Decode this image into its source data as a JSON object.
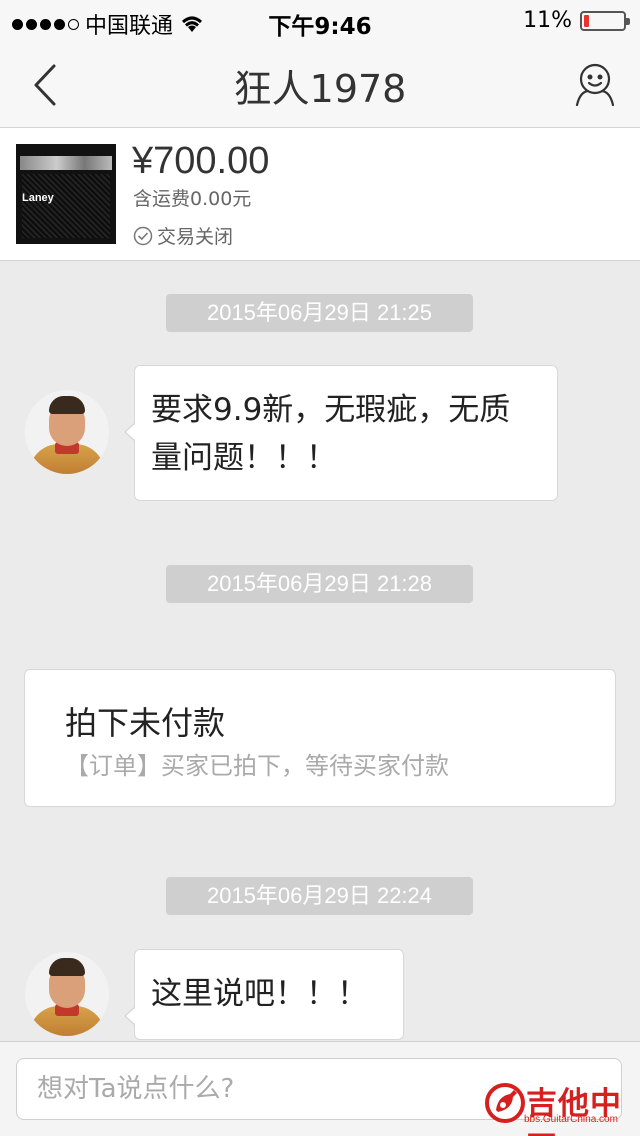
{
  "status_bar": {
    "carrier": "中国联通",
    "time": "下午9:46",
    "battery_percent": "11%",
    "battery_level": 0.11
  },
  "nav": {
    "title": "狂人1978",
    "back_icon": "chevron-left-icon",
    "profile_icon": "user-face-icon"
  },
  "product": {
    "image_brand": "Laney",
    "price": "¥700.00",
    "shipping": "含运费0.00元",
    "status": "交易关闭"
  },
  "messages": [
    {
      "type": "timestamp",
      "text": "2015年06月29日 21:25"
    },
    {
      "type": "bubble",
      "lines": [
        "要求9.9新，无瑕疵，无质",
        "量问题！！！"
      ]
    },
    {
      "type": "timestamp",
      "text": "2015年06月29日 21:28"
    },
    {
      "type": "order",
      "title": "拍下未付款",
      "desc": "【订单】买家已拍下，等待买家付款"
    },
    {
      "type": "timestamp",
      "text": "2015年06月29日 22:24"
    },
    {
      "type": "bubble",
      "lines": [
        "这里说吧！！！"
      ]
    }
  ],
  "input": {
    "placeholder": "想对Ta说点什么?"
  },
  "watermark": {
    "name": "吉他中国",
    "url": "bbs.GuitarChina.com"
  },
  "colors": {
    "accent_red": "#e8342e",
    "background": "#ebebeb",
    "timestamp_bg": "#cfcfcf"
  }
}
